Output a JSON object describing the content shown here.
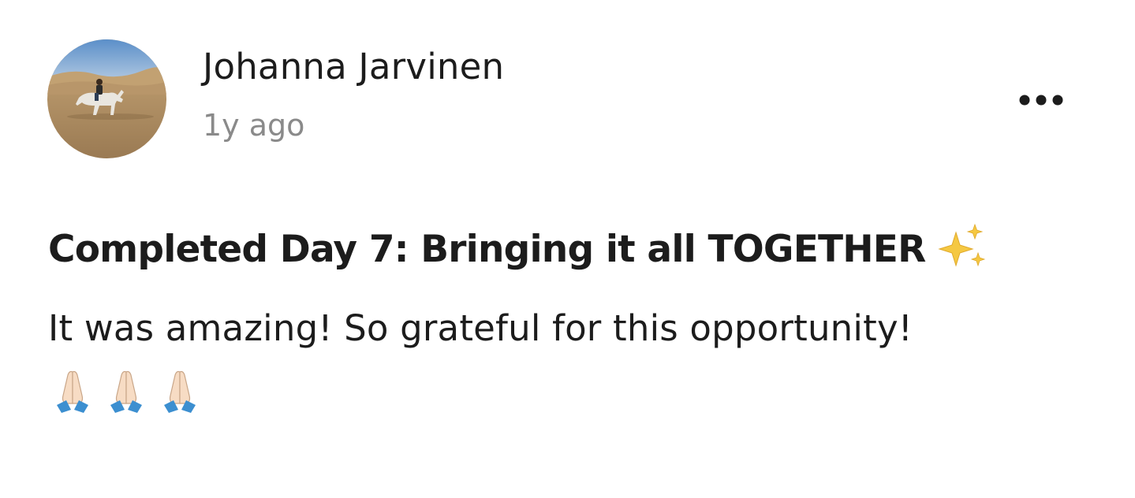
{
  "post": {
    "author": {
      "name": "Johanna Jarvinen",
      "avatar_icon": "avatar-horse-rider-desert"
    },
    "timestamp": "1y ago",
    "more_icon": "more-horizontal-icon",
    "title": "Completed Day 7: Bringing it all TOGETHER",
    "title_emoji": "sparkles-icon",
    "body": "It was amazing! So grateful for this opportunity!",
    "body_emojis": [
      "folded-hands-icon",
      "folded-hands-icon",
      "folded-hands-icon"
    ]
  },
  "colors": {
    "text_primary": "#1c1c1c",
    "text_secondary": "#8a8a8a",
    "sparkle_gold": "#f5c842",
    "sleeve_blue": "#3c8fd0",
    "skin_light": "#f7dcc4"
  }
}
